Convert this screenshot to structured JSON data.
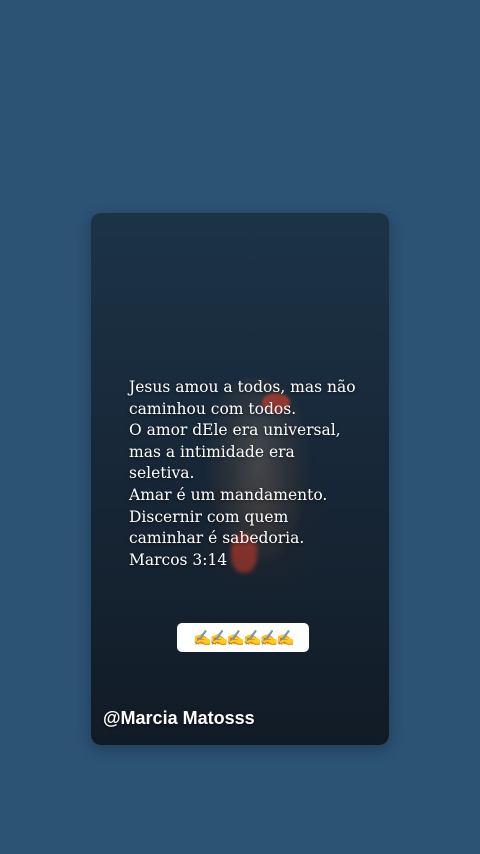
{
  "story": {
    "quote_lines": [
      "Jesus amou a todos, mas não",
      "caminhou com todos.",
      "O amor dEle era universal,",
      "mas a intimidade era",
      "seletiva.",
      "Amar é um mandamento.",
      "Discernir com quem",
      "caminhar é sabedoria.",
      "Marcos 3:14"
    ],
    "emoji_sticker": "✍️✍️✍️✍️✍️✍️",
    "username": "@Marcia Matosss"
  },
  "colors": {
    "page_background": "#2c5274",
    "card_background": "#18293a",
    "text": "#ffffff",
    "sticker_background": "#ffffff"
  }
}
